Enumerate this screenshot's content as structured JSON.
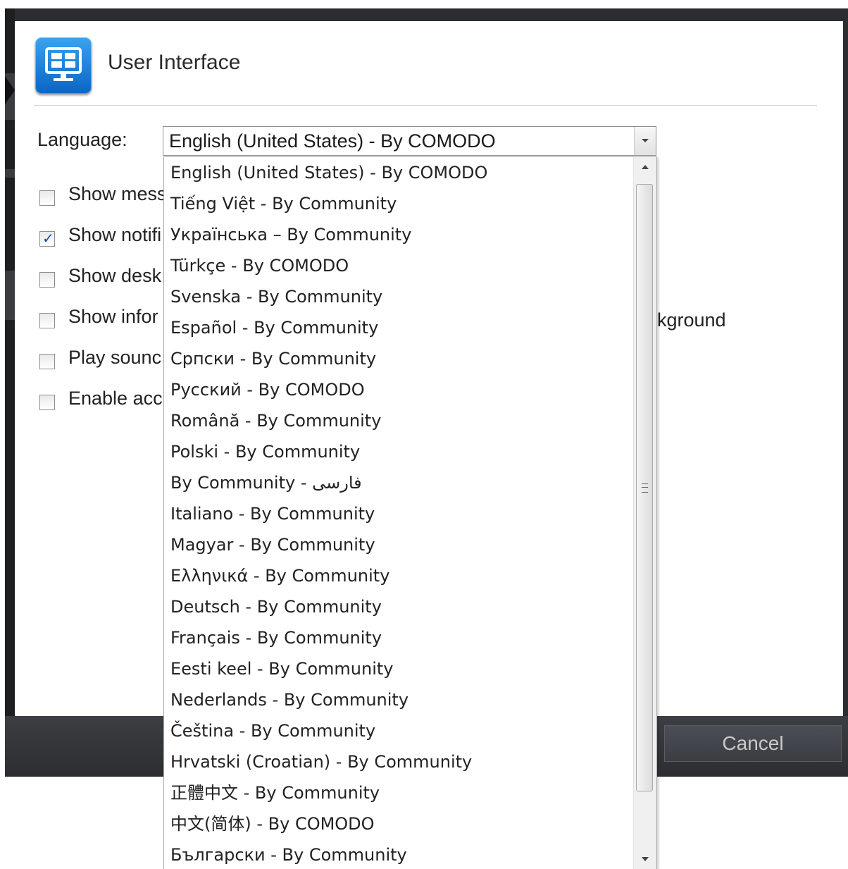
{
  "panel": {
    "title": "User Interface",
    "icon": "monitor-grid-icon"
  },
  "language": {
    "label": "Language:",
    "selected": "English (United States) - By COMODO",
    "options": [
      "English (United States) - By COMODO",
      "Tiếng Việt - By Community",
      "Українська – By Community",
      "Türkçe - By COMODO",
      "Svenska - By Community",
      "Español - By Community",
      "Српски - By Community",
      "Русский - By COMODO",
      "Română - By Community",
      "Polski - By Community",
      "By Community - فارسی",
      "Italiano - By Community",
      "Magyar - By Community",
      "Ελληνικά - By Community",
      "Deutsch - By Community",
      "Français - By Community",
      "Eesti keel - By Community",
      "Nederlands - By Community",
      "Čeština - By Community",
      "Hrvatski (Croatian) - By Community",
      "正體中文 - By Community",
      "中文(简体) - By COMODO",
      "Български - By Community"
    ]
  },
  "options": [
    {
      "label": "Show mess",
      "checked": false
    },
    {
      "label": "Show notifi",
      "checked": true
    },
    {
      "label": "Show desk",
      "checked": false
    },
    {
      "label": "Show infor",
      "checked": false
    },
    {
      "label": "Play sounc",
      "checked": false
    },
    {
      "label": "Enable acc",
      "checked": false
    }
  ],
  "partial_right_text": "kground",
  "buttons": {
    "cancel": "Cancel"
  },
  "colors": {
    "frame": "#2b2d30",
    "icon_blue": "#1a82dd",
    "check": "#1b4da8"
  }
}
